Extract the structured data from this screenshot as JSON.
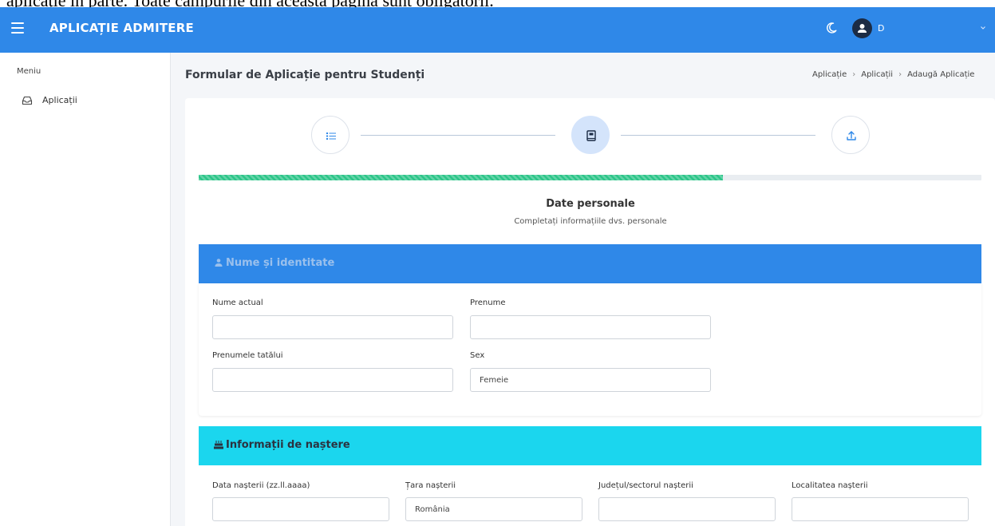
{
  "doc_caption": "aplicație în parte. Toate câmpurile din această pagină sunt obligatorii.",
  "header": {
    "app_title": "APLICAȚIE ADMITERE",
    "user_name": "D",
    "menu_icon": "hamburger-icon",
    "theme_icon": "moon-icon",
    "avatar_icon": "user-icon",
    "dropdown_icon": "chevron-down-icon",
    "brand_color": "#2f88e8"
  },
  "sidebar": {
    "heading": "Meniu",
    "items": [
      {
        "label": "Aplicații",
        "icon": "inbox-icon"
      }
    ]
  },
  "page": {
    "title": "Formular de Aplicație pentru Studenți",
    "breadcrumb": [
      "Aplicație",
      "Aplicații",
      "Adaugă Aplicație"
    ]
  },
  "wizard": {
    "steps": [
      {
        "icon": "list-icon",
        "active": false
      },
      {
        "icon": "book-icon",
        "active": true
      },
      {
        "icon": "upload-icon",
        "active": false
      }
    ],
    "progress": 0.67,
    "progress_color": "#2dc589",
    "section_title": "Date personale",
    "section_subtitle": "Completați informațiile dvs. personale"
  },
  "identity": {
    "title": "Nume și identitate",
    "icon": "user-icon",
    "header_color": "#2f88e8",
    "fields": {
      "last_name": {
        "label": "Nume actual",
        "value": ""
      },
      "first_name": {
        "label": "Prenume",
        "value": ""
      },
      "father_name": {
        "label": "Prenumele tatălui",
        "value": ""
      },
      "sex": {
        "label": "Sex",
        "value": "Femeie"
      }
    }
  },
  "birth": {
    "title": "Informații de naștere",
    "icon": "cake-icon",
    "header_color": "#1bd6ee",
    "fields": {
      "birth_date": {
        "label": "Data nașterii (zz.ll.aaaa)",
        "value": ""
      },
      "birth_country": {
        "label": "Țara nașterii",
        "value": "România"
      },
      "birth_county": {
        "label": "Județul/sectorul nașterii",
        "value": ""
      },
      "birth_city": {
        "label": "Localitatea nașterii",
        "value": ""
      }
    }
  }
}
